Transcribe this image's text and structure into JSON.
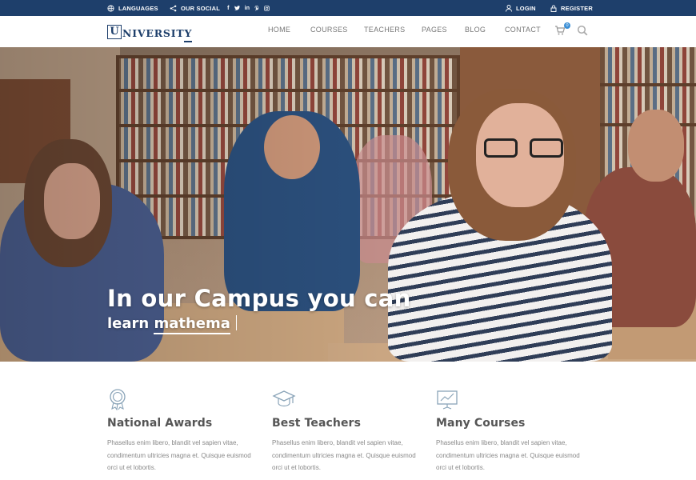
{
  "topbar": {
    "languages": "LANGUAGES",
    "our_social": "OUR SOCIAL",
    "social_icons": [
      "f",
      "t",
      "in",
      "p",
      "ig"
    ],
    "login": "LOGIN",
    "register": "REGISTER"
  },
  "header": {
    "logo_initial": "U",
    "logo_rest": "NIVERSITY",
    "nav": [
      "HOME",
      "COURSES",
      "TEACHERS",
      "PAGES",
      "BLOG",
      "CONTACT"
    ],
    "cart_count": "0"
  },
  "hero": {
    "headline": "In our Campus you can",
    "subline_prefix": "learn ",
    "typed_word": "mathema"
  },
  "features": [
    {
      "icon": "award-icon",
      "title": "National Awards",
      "text": "Phasellus enim libero, blandit vel sapien vitae, condimentum ultricies magna et. Quisque euismod orci ut et lobortis."
    },
    {
      "icon": "graduation-cap-icon",
      "title": "Best Teachers",
      "text": "Phasellus enim libero, blandit vel sapien vitae, condimentum ultricies magna et. Quisque euismod orci ut et lobortis."
    },
    {
      "icon": "presentation-chart-icon",
      "title": "Many Courses",
      "text": "Phasellus enim libero, blandit vel sapien vitae, condimentum ultricies magna et. Quisque euismod orci ut et lobortis."
    }
  ],
  "colors": {
    "primary": "#1e3f6b",
    "accent": "#3b8fd6"
  }
}
